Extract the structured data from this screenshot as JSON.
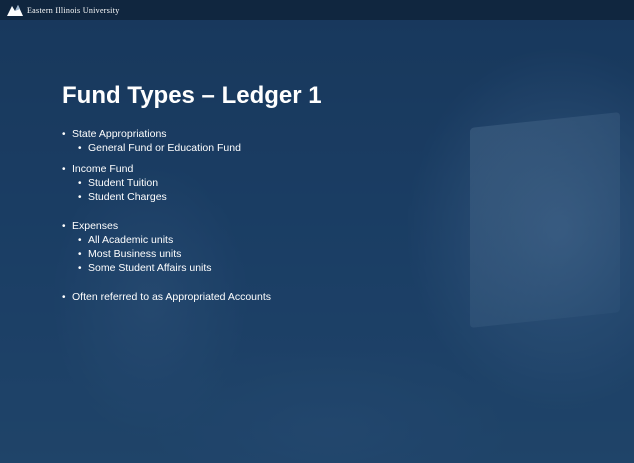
{
  "header": {
    "logo_text": "Eastern Illinois University"
  },
  "slide": {
    "title": "Fund Types – Ledger 1",
    "bullet_glyph": "•",
    "items": [
      {
        "level": 1,
        "text": "State Appropriations"
      },
      {
        "level": 2,
        "text": "General Fund or Education Fund"
      },
      {
        "level": 1,
        "text": "Income Fund"
      },
      {
        "level": 2,
        "text": "Student Tuition"
      },
      {
        "level": 2,
        "text": "Student Charges"
      },
      {
        "level": 1,
        "text": "Expenses"
      },
      {
        "level": 2,
        "text": "All Academic units"
      },
      {
        "level": 2,
        "text": "Most Business units"
      },
      {
        "level": 2,
        "text": "Some Student Affairs units"
      },
      {
        "level": 1,
        "text": "Often referred to as Appropriated Accounts"
      }
    ]
  },
  "colors": {
    "background": "#1f3f63",
    "text": "#ffffff",
    "header_bar": "#10263f"
  },
  "icons": {
    "logo": "eiu-logo-icon"
  }
}
